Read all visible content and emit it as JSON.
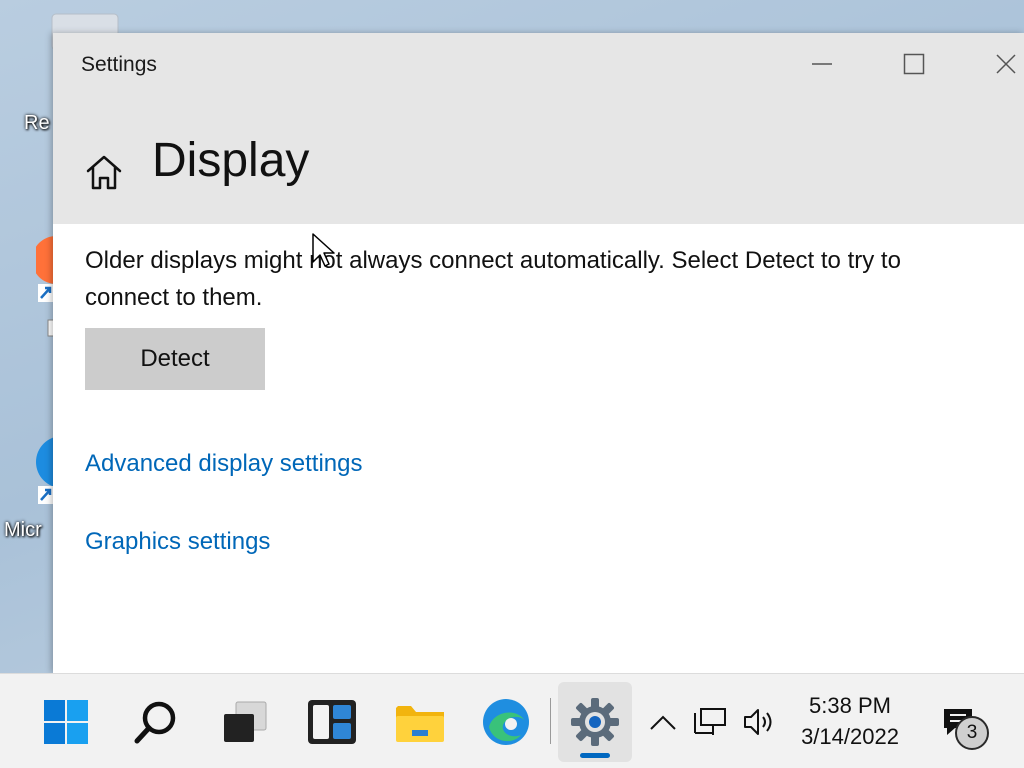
{
  "desktop": {
    "icons": [
      {
        "label": "Re"
      },
      {
        "label": "Micr"
      }
    ]
  },
  "window": {
    "title": "Settings",
    "page_title": "Display",
    "description": "Older displays might not always connect automatically. Select Detect to try to connect to them.",
    "detect_label": "Detect",
    "links": {
      "advanced": "Advanced display settings",
      "graphics": "Graphics settings"
    }
  },
  "taskbar": {
    "time": "5:38 PM",
    "date": "3/14/2022",
    "notification_count": "3",
    "accent": "#0067c0"
  },
  "colors": {
    "link": "#0067b8",
    "header_bg": "#e6e6e6",
    "button_bg": "#cccccc"
  }
}
